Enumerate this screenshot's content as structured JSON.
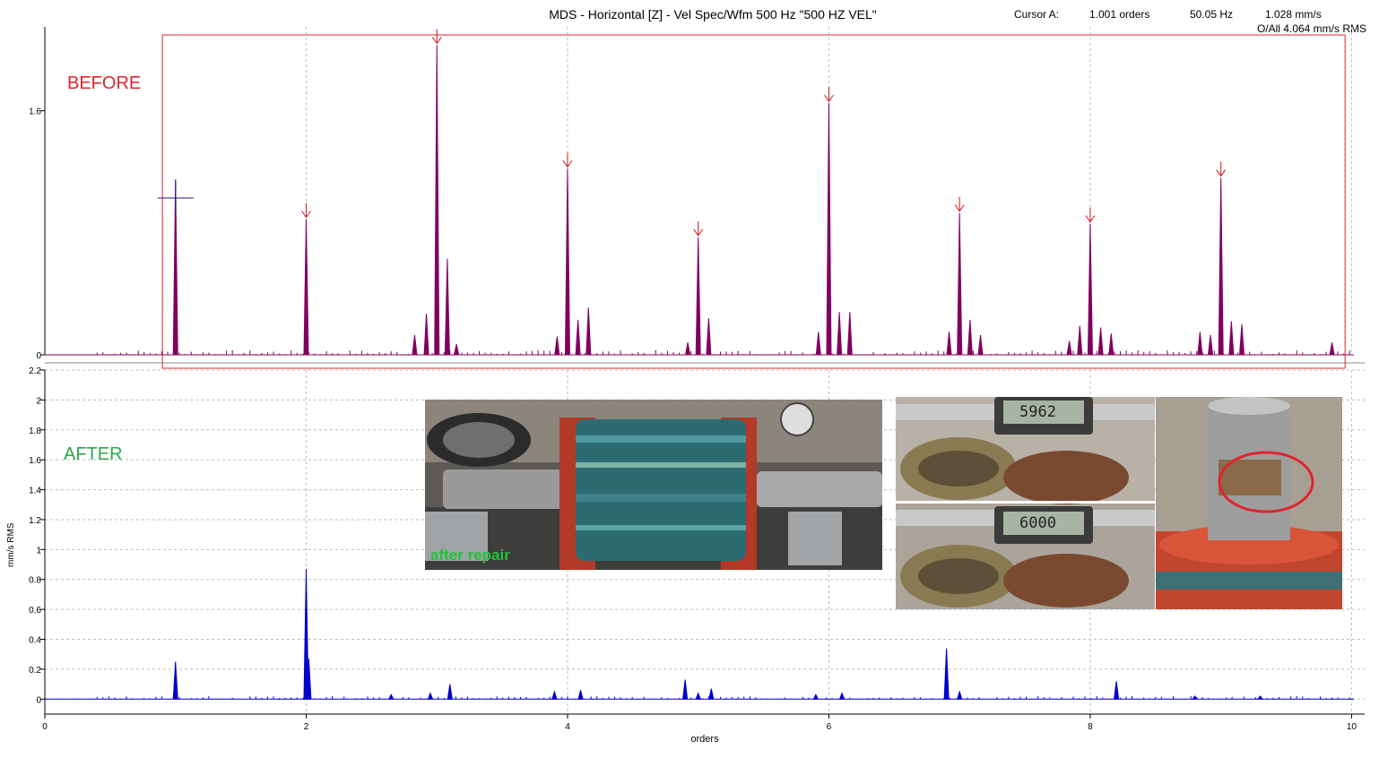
{
  "header": {
    "title": "MDS - Horizontal [Z] - Vel Spec/Wfm 500 Hz \"500 HZ VEL\"",
    "cursor_label": "Cursor A:",
    "cursor_orders": "1.001 orders",
    "cursor_freq": "50.05 Hz",
    "cursor_amp": "1.028 mm/s",
    "overall": "O/All 4.064 mm/s RMS"
  },
  "annotations": {
    "before_label": "BEFORE",
    "after_label": "AFTER",
    "after_repair_caption": "after repair",
    "caliper_reading_top": "5962",
    "caliper_reading_bottom": "6000"
  },
  "colors": {
    "before_trace": "#800060",
    "after_trace": "#0000cc",
    "highlight_box": "#e0242e",
    "arrow": "#d01818",
    "grid": "#bdbdbd"
  },
  "chart_data": [
    {
      "type": "line",
      "name": "before",
      "ytick_labels": [
        "1.6",
        "0"
      ],
      "ylim": [
        0,
        2.15
      ],
      "xlim": [
        0,
        10.1
      ],
      "peaks": [
        {
          "x": 1.0,
          "y": 1.15
        },
        {
          "x": 2.0,
          "y": 0.89
        },
        {
          "x": 2.83,
          "y": 0.13
        },
        {
          "x": 2.92,
          "y": 0.27
        },
        {
          "x": 3.0,
          "y": 2.03
        },
        {
          "x": 3.08,
          "y": 0.63
        },
        {
          "x": 3.15,
          "y": 0.07
        },
        {
          "x": 3.92,
          "y": 0.12
        },
        {
          "x": 4.0,
          "y": 1.22
        },
        {
          "x": 4.08,
          "y": 0.23
        },
        {
          "x": 4.16,
          "y": 0.31
        },
        {
          "x": 4.92,
          "y": 0.08
        },
        {
          "x": 5.0,
          "y": 0.77
        },
        {
          "x": 5.08,
          "y": 0.24
        },
        {
          "x": 5.92,
          "y": 0.15
        },
        {
          "x": 6.0,
          "y": 1.65
        },
        {
          "x": 6.08,
          "y": 0.28
        },
        {
          "x": 6.16,
          "y": 0.28
        },
        {
          "x": 6.92,
          "y": 0.15
        },
        {
          "x": 7.0,
          "y": 0.93
        },
        {
          "x": 7.08,
          "y": 0.23
        },
        {
          "x": 7.16,
          "y": 0.13
        },
        {
          "x": 7.84,
          "y": 0.09
        },
        {
          "x": 7.92,
          "y": 0.19
        },
        {
          "x": 8.0,
          "y": 0.86
        },
        {
          "x": 8.08,
          "y": 0.18
        },
        {
          "x": 8.16,
          "y": 0.14
        },
        {
          "x": 8.84,
          "y": 0.15
        },
        {
          "x": 8.92,
          "y": 0.13
        },
        {
          "x": 9.0,
          "y": 1.16
        },
        {
          "x": 9.08,
          "y": 0.22
        },
        {
          "x": 9.16,
          "y": 0.2
        },
        {
          "x": 9.85,
          "y": 0.08
        }
      ],
      "arrow_marks_x": [
        2,
        3,
        4,
        5,
        6,
        7,
        8,
        9
      ],
      "cursor": {
        "x": 1.001,
        "y": 1.028
      },
      "highlight_range_x": [
        0.9,
        9.95
      ]
    },
    {
      "type": "line",
      "name": "after",
      "ylabel": "mm/s RMS",
      "xlabel": "orders",
      "ylim": [
        -0.1,
        2.2
      ],
      "xlim": [
        0,
        10.1
      ],
      "yticks": [
        0,
        0.2,
        0.4,
        0.6,
        0.8,
        1,
        1.2,
        1.4,
        1.6,
        1.8,
        2,
        2.2
      ],
      "ytick_labels": [
        "0",
        "0.2",
        "0.4",
        "0.6",
        "0.8",
        "1",
        "1.2",
        "1.4",
        "1.6",
        "1.8",
        "2",
        "2.2"
      ],
      "xticks": [
        0,
        2,
        4,
        6,
        8,
        10
      ],
      "xtick_labels": [
        "0",
        "2",
        "4",
        "6",
        "8",
        "10"
      ],
      "grid": true,
      "peaks": [
        {
          "x": 1.0,
          "y": 0.25
        },
        {
          "x": 2.0,
          "y": 0.87
        },
        {
          "x": 2.02,
          "y": 0.27
        },
        {
          "x": 2.65,
          "y": 0.03
        },
        {
          "x": 2.95,
          "y": 0.04
        },
        {
          "x": 3.1,
          "y": 0.1
        },
        {
          "x": 3.9,
          "y": 0.05
        },
        {
          "x": 4.1,
          "y": 0.06
        },
        {
          "x": 4.9,
          "y": 0.13
        },
        {
          "x": 5.0,
          "y": 0.04
        },
        {
          "x": 5.1,
          "y": 0.07
        },
        {
          "x": 5.9,
          "y": 0.03
        },
        {
          "x": 6.1,
          "y": 0.04
        },
        {
          "x": 6.9,
          "y": 0.34
        },
        {
          "x": 7.0,
          "y": 0.05
        },
        {
          "x": 8.2,
          "y": 0.12
        },
        {
          "x": 8.8,
          "y": 0.02
        },
        {
          "x": 9.3,
          "y": 0.02
        }
      ]
    }
  ]
}
